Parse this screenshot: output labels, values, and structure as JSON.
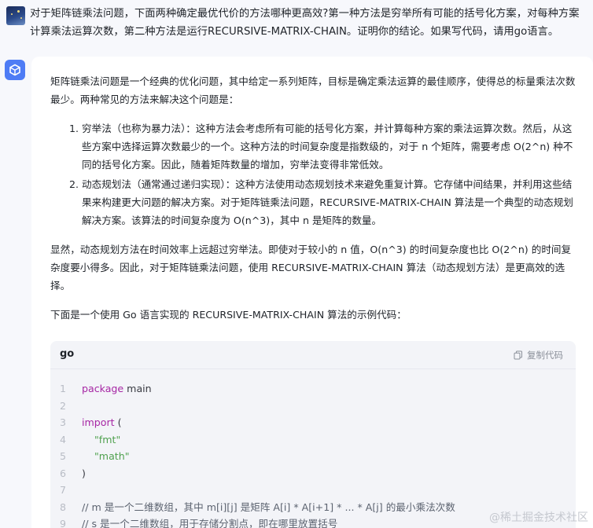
{
  "question": {
    "text": "对于矩阵链乘法问题，下面两种确定最优代价的方法哪种更高效?第一种方法是穷举所有可能的括号化方案，对每种方案计算乘法运算次数，第二种方法是运行RECURSIVE-MATRIX-CHAIN。证明你的结论。如果写代码，请用go语言。"
  },
  "answer": {
    "intro": "矩阵链乘法问题是一个经典的优化问题，其中给定一系列矩阵，目标是确定乘法运算的最佳顺序，使得总的标量乘法次数最少。两种常见的方法来解决这个问题是：",
    "items": [
      "穷举法（也称为暴力法）：这种方法会考虑所有可能的括号化方案，并计算每种方案的乘法运算次数。然后，从这些方案中选择运算次数最少的一个。这种方法的时间复杂度是指数级的，对于 n 个矩阵，需要考虑 O(2^n) 种不同的括号化方案。因此，随着矩阵数量的增加，穷举法变得非常低效。",
      "动态规划法（通常通过递归实现）：这种方法使用动态规划技术来避免重复计算。它存储中间结果，并利用这些结果来构建更大问题的解决方案。对于矩阵链乘法问题，RECURSIVE-MATRIX-CHAIN 算法是一个典型的动态规划解决方案。该算法的时间复杂度为 O(n^3)，其中 n 是矩阵的数量。"
    ],
    "conclusion": "显然，动态规划方法在时间效率上远超过穷举法。即使对于较小的 n 值，O(n^3) 的时间复杂度也比 O(2^n) 的时间复杂度要小得多。因此，对于矩阵链乘法问题，使用 RECURSIVE-MATRIX-CHAIN 算法（动态规划方法）是更高效的选择。",
    "code_intro": "下面是一个使用 Go 语言实现的 RECURSIVE-MATRIX-CHAIN 算法的示例代码："
  },
  "code": {
    "language": "go",
    "copy_label": "复制代码",
    "lines": [
      {
        "n": "1",
        "tokens": [
          {
            "t": "kw",
            "v": "package"
          },
          {
            "t": "plain",
            "v": " main"
          }
        ]
      },
      {
        "n": "2",
        "tokens": []
      },
      {
        "n": "3",
        "tokens": [
          {
            "t": "kw",
            "v": "import"
          },
          {
            "t": "plain",
            "v": " ("
          }
        ]
      },
      {
        "n": "4",
        "tokens": [
          {
            "t": "plain",
            "v": "    "
          },
          {
            "t": "str",
            "v": "\"fmt\""
          }
        ]
      },
      {
        "n": "5",
        "tokens": [
          {
            "t": "plain",
            "v": "    "
          },
          {
            "t": "str",
            "v": "\"math\""
          }
        ]
      },
      {
        "n": "6",
        "tokens": [
          {
            "t": "plain",
            "v": ")"
          }
        ]
      },
      {
        "n": "7",
        "tokens": []
      },
      {
        "n": "8",
        "tokens": [
          {
            "t": "com",
            "v": "// m 是一个二维数组，其中 m[i][j] 是矩阵 A[i] * A[i+1] * ... * A[j] 的最小乘法次数"
          }
        ]
      },
      {
        "n": "9",
        "tokens": [
          {
            "t": "com",
            "v": "// s 是一个二维数组，用于存储分割点，即在哪里放置括号"
          }
        ]
      }
    ]
  },
  "watermark": "@稀土掘金技术社区",
  "colors": {
    "page_bg": "#f7f8fc",
    "card_bg": "#ffffff",
    "code_bg": "#f3f4f8",
    "bot_avatar": "#4e7cf5",
    "keyword": "#a626a4",
    "string": "#50a14f"
  }
}
